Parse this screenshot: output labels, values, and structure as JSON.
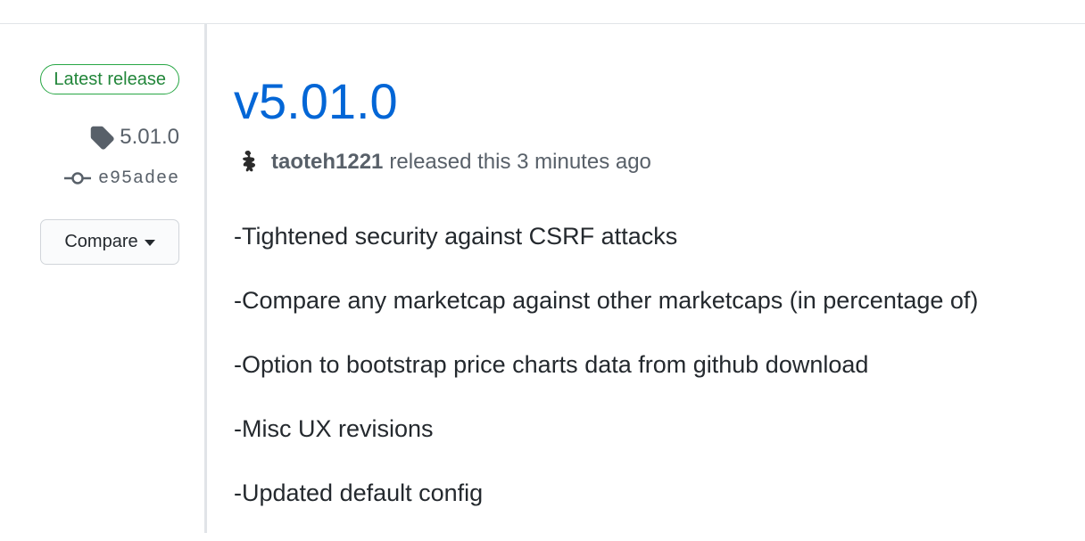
{
  "sidebar": {
    "badge": "Latest release",
    "tag": "5.01.0",
    "commit": "e95adee",
    "compare_label": "Compare"
  },
  "release": {
    "title": "v5.01.0",
    "author": "taoteh1221",
    "released_text": "released this 3 minutes ago",
    "notes": [
      "-Tightened security against CSRF attacks",
      "-Compare any marketcap against other marketcaps (in percentage of)",
      "-Option to bootstrap price charts data from github download",
      "-Misc UX revisions",
      "-Updated default config"
    ]
  },
  "icons": {
    "tag": "tag-icon",
    "commit": "git-commit-icon",
    "caret": "caret-down-icon",
    "avatar": "avatar"
  },
  "colors": {
    "link": "#0366d6",
    "badge_green": "#22863a",
    "muted": "#586069",
    "border": "#e1e4e8"
  }
}
